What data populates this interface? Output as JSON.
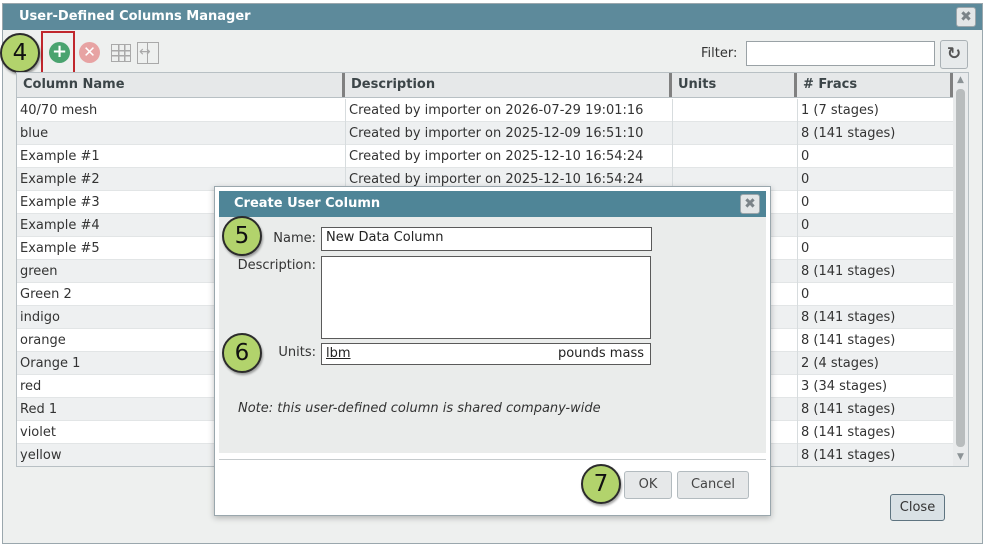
{
  "window": {
    "title": "User-Defined Columns Manager",
    "close_glyph": "✖"
  },
  "toolbar": {
    "add_glyph": "+",
    "delete_glyph": "✕",
    "filter_label": "Filter:",
    "filter_value": "",
    "refresh_glyph": "↻"
  },
  "callouts": {
    "c4": "4",
    "c5": "5",
    "c6": "6",
    "c7": "7"
  },
  "grid": {
    "headers": {
      "name": "Column Name",
      "description": "Description",
      "units": "Units",
      "fracs": "# Fracs"
    },
    "rows": [
      {
        "name": "40/70 mesh",
        "description": "Created by importer on 2026-07-29 19:01:16",
        "units": "",
        "fracs": "1 (7 stages)"
      },
      {
        "name": "blue",
        "description": "Created by importer on 2025-12-09 16:51:10",
        "units": "",
        "fracs": "8 (141 stages)"
      },
      {
        "name": "Example #1",
        "description": "Created by importer on 2025-12-10 16:54:24",
        "units": "",
        "fracs": "0"
      },
      {
        "name": "Example #2",
        "description": "Created by importer on 2025-12-10 16:54:24",
        "units": "",
        "fracs": "0"
      },
      {
        "name": "Example #3",
        "description": "",
        "units": "",
        "fracs": "0"
      },
      {
        "name": "Example #4",
        "description": "",
        "units": "",
        "fracs": "0"
      },
      {
        "name": "Example #5",
        "description": "",
        "units": "",
        "fracs": "0"
      },
      {
        "name": "green",
        "description": "",
        "units": "",
        "fracs": "8 (141 stages)"
      },
      {
        "name": "Green 2",
        "description": "",
        "units": "",
        "fracs": "0"
      },
      {
        "name": "indigo",
        "description": "",
        "units": "",
        "fracs": "8 (141 stages)"
      },
      {
        "name": "orange",
        "description": "",
        "units": "",
        "fracs": "8 (141 stages)"
      },
      {
        "name": "Orange 1",
        "description": "",
        "units": "",
        "fracs": "2 (4 stages)"
      },
      {
        "name": "red",
        "description": "",
        "units": "",
        "fracs": "3 (34 stages)"
      },
      {
        "name": "Red 1",
        "description": "",
        "units": "",
        "fracs": "8 (141 stages)"
      },
      {
        "name": "violet",
        "description": "",
        "units": "",
        "fracs": "8 (141 stages)"
      },
      {
        "name": "yellow",
        "description": "",
        "units": "",
        "fracs": "8 (141 stages)"
      }
    ]
  },
  "close_button": "Close",
  "dialog": {
    "title": "Create User Column",
    "close_glyph": "✖",
    "name_label": "Name:",
    "name_value": "New Data Column",
    "description_label": "Description:",
    "description_value": "",
    "units_label": "Units:",
    "units_value": "lbm",
    "units_desc": "pounds mass",
    "note": "Note: this user-defined column is shared company-wide",
    "ok_label": "OK",
    "cancel_label": "Cancel"
  }
}
